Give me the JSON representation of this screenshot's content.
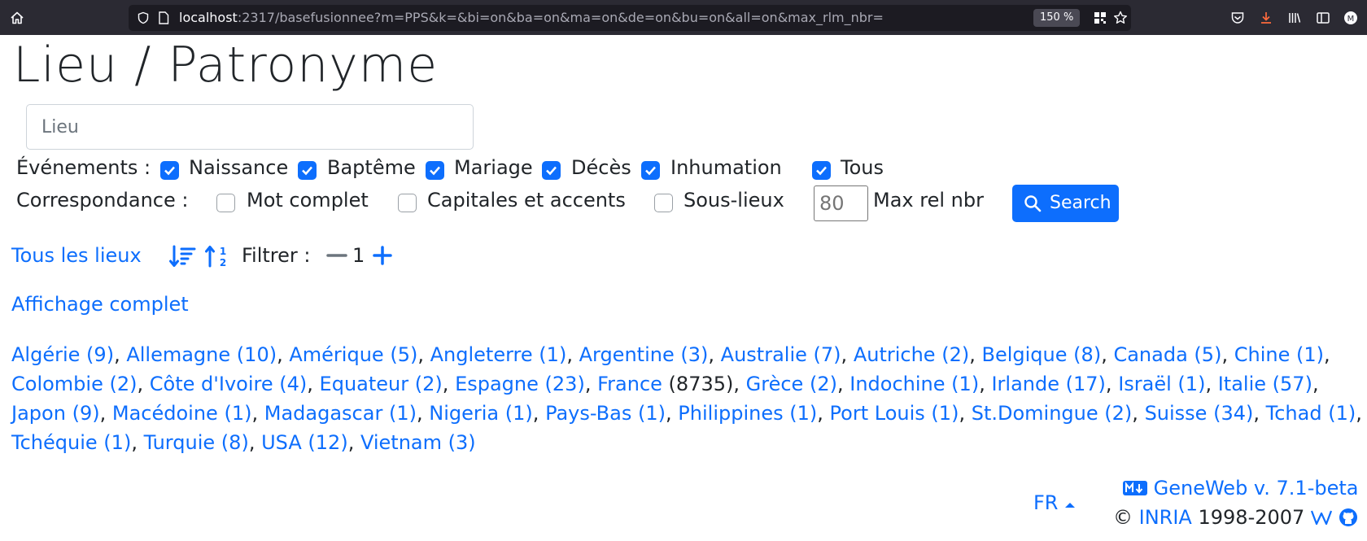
{
  "browser": {
    "url_host": "localhost",
    "url_rest": ":2317/basefusionnee?m=PPS&k=&bi=on&ba=on&ma=on&de=on&bu=on&all=on&max_rlm_nbr=",
    "zoom": "150 %"
  },
  "page": {
    "title": "Lieu / Patronyme",
    "place_placeholder": "Lieu"
  },
  "events": {
    "label": "Événements :",
    "items": [
      {
        "label": "Naissance",
        "checked": true
      },
      {
        "label": "Baptême",
        "checked": true
      },
      {
        "label": "Mariage",
        "checked": true
      },
      {
        "label": "Décès",
        "checked": true
      },
      {
        "label": "Inhumation",
        "checked": true
      },
      {
        "label": "Tous",
        "checked": true
      }
    ]
  },
  "matching": {
    "label": "Correspondance :",
    "items": [
      {
        "label": "Mot complet",
        "checked": false
      },
      {
        "label": "Capitales et accents",
        "checked": false
      },
      {
        "label": "Sous-lieux",
        "checked": false
      }
    ],
    "max_rel_placeholder": "80",
    "max_rel_label": "Max rel nbr",
    "search_label": "Search"
  },
  "filter": {
    "all_places_link": "Tous les lieux",
    "filter_label": "Filtrer :",
    "filter_value": "1",
    "full_display_link": "Affichage complet"
  },
  "places": [
    {
      "name": "Algérie",
      "count": "9"
    },
    {
      "name": "Allemagne",
      "count": "10"
    },
    {
      "name": "Amérique",
      "count": "5"
    },
    {
      "name": "Angleterre",
      "count": "1"
    },
    {
      "name": "Argentine",
      "count": "3"
    },
    {
      "name": "Australie",
      "count": "7"
    },
    {
      "name": "Autriche",
      "count": "2"
    },
    {
      "name": "Belgique",
      "count": "8"
    },
    {
      "name": "Canada",
      "count": "5"
    },
    {
      "name": "Chine",
      "count": "1"
    },
    {
      "name": "Colombie",
      "count": "2"
    },
    {
      "name": "Côte d'Ivoire",
      "count": "4"
    },
    {
      "name": "Equateur",
      "count": "2"
    },
    {
      "name": "Espagne",
      "count": "23"
    },
    {
      "name": "France",
      "count": "8735"
    },
    {
      "name": "Grèce",
      "count": "2"
    },
    {
      "name": "Indochine",
      "count": "1"
    },
    {
      "name": "Irlande",
      "count": "17"
    },
    {
      "name": "Israël",
      "count": "1"
    },
    {
      "name": "Italie",
      "count": "57"
    },
    {
      "name": "Japon",
      "count": "9"
    },
    {
      "name": "Macédoine",
      "count": "1"
    },
    {
      "name": "Madagascar",
      "count": "1"
    },
    {
      "name": "Nigeria",
      "count": "1"
    },
    {
      "name": "Pays-Bas",
      "count": "1"
    },
    {
      "name": "Philippines",
      "count": "1"
    },
    {
      "name": "Port Louis",
      "count": "1"
    },
    {
      "name": "St.Domingue",
      "count": "2"
    },
    {
      "name": "Suisse",
      "count": "34"
    },
    {
      "name": "Tchad",
      "count": "1"
    },
    {
      "name": "Tchéquie",
      "count": "1"
    },
    {
      "name": "Turquie",
      "count": "8"
    },
    {
      "name": "USA",
      "count": "12"
    },
    {
      "name": "Vietnam",
      "count": "3"
    }
  ],
  "footer": {
    "lang": "FR",
    "geneweb": "GeneWeb v. 7.1-beta",
    "copyright": "©",
    "inria": "INRIA",
    "years": "1998-2007"
  },
  "colors": {
    "accent": "#0d6efd",
    "chrome_bg": "#2b2a33",
    "urlbar_bg": "#1c1b22"
  }
}
